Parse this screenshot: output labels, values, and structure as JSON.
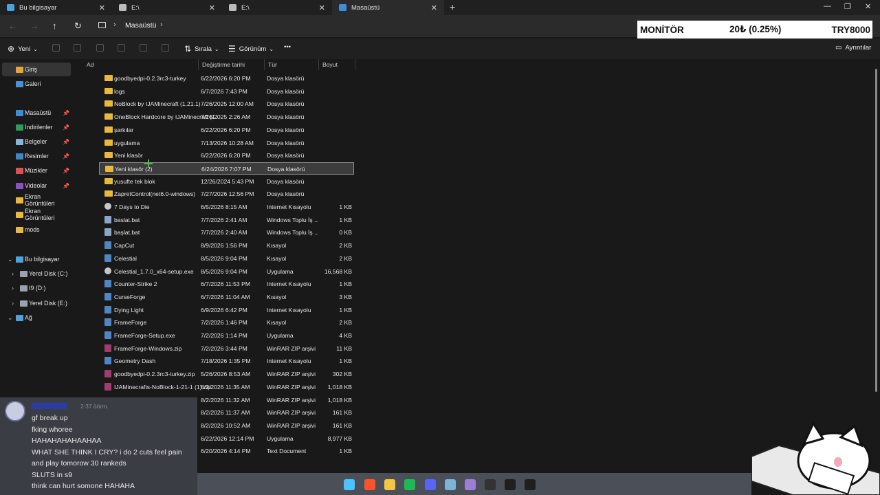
{
  "tabs": [
    {
      "label": "Bu bilgisayar",
      "active": false
    },
    {
      "label": "E:\\",
      "active": false
    },
    {
      "label": "E:\\",
      "active": false
    },
    {
      "label": "Masaüstü",
      "active": true
    }
  ],
  "address": {
    "crumb": "Masaüstü"
  },
  "ticker": {
    "label": "MONİTÖR",
    "change": "20₺ (0.25%)",
    "price": "TRY8000"
  },
  "toolbar": {
    "new_label": "Yeni",
    "sort_label": "Sırala",
    "view_label": "Görünüm",
    "more_label": "•••",
    "details_label": "Ayrıntılar"
  },
  "sidebar": {
    "items": [
      {
        "label": "Giriş",
        "icon": "home-icon",
        "color": "#e8a33a",
        "selected": true,
        "pinned": false
      },
      {
        "label": "Galeri",
        "icon": "gallery-icon",
        "color": "#4a90d9",
        "selected": false,
        "pinned": false
      },
      {
        "label": "Masaüstü",
        "icon": "desktop-icon",
        "color": "#3a8fd8",
        "selected": false,
        "pinned": true
      },
      {
        "label": "İndirilenler",
        "icon": "download-icon",
        "color": "#2a9d5a",
        "selected": false,
        "pinned": true
      },
      {
        "label": "Belgeler",
        "icon": "documents-icon",
        "color": "#8ab4e0",
        "selected": false,
        "pinned": true
      },
      {
        "label": "Resimler",
        "icon": "pictures-icon",
        "color": "#3a86c8",
        "selected": false,
        "pinned": true
      },
      {
        "label": "Müzikler",
        "icon": "music-icon",
        "color": "#d9534f",
        "selected": false,
        "pinned": true
      },
      {
        "label": "Videolar",
        "icon": "videos-icon",
        "color": "#8a4fc6",
        "selected": false,
        "pinned": true
      },
      {
        "label": "Ekran Görüntüleri",
        "icon": "folder-icon",
        "color": "#e9b83c",
        "selected": false,
        "pinned": false
      },
      {
        "label": "Ekran Görüntüleri",
        "icon": "folder-icon",
        "color": "#e9b83c",
        "selected": false,
        "pinned": false
      },
      {
        "label": "mods",
        "icon": "folder-icon",
        "color": "#e9b83c",
        "selected": false,
        "pinned": false
      }
    ],
    "pc": {
      "label": "Bu bilgisayar"
    },
    "drives": [
      {
        "label": "Yerel Disk (C:)"
      },
      {
        "label": "I9 (D:)"
      },
      {
        "label": "Yerel Disk (E:)"
      }
    ],
    "network": {
      "label": "Ağ"
    }
  },
  "columns": {
    "name": "Ad",
    "modified": "Değiştirme tarihi",
    "type": "Tür",
    "size": "Boyut"
  },
  "files": [
    {
      "name": "goodbyedpi-0.2.3rc3-turkey",
      "date": "6/22/2026 6:20 PM",
      "type": "Dosya klasörü",
      "size": "",
      "kind": "folder"
    },
    {
      "name": "logs",
      "date": "6/7/2026 7:43 PM",
      "type": "Dosya klasörü",
      "size": "",
      "kind": "folder"
    },
    {
      "name": "NoBlock by IJAMinecraft (1.21.1)",
      "date": "7/26/2025 12:00 AM",
      "type": "Dosya klasörü",
      "size": "",
      "kind": "folder"
    },
    {
      "name": "OneBlock Hardcore by IJAMinecraft (1.21...",
      "date": "7/26/2025 2:26 AM",
      "type": "Dosya klasörü",
      "size": "",
      "kind": "folder"
    },
    {
      "name": "şarkılar",
      "date": "6/22/2026 6:20 PM",
      "type": "Dosya klasörü",
      "size": "",
      "kind": "folder"
    },
    {
      "name": "uygulama",
      "date": "7/13/2026 10:28 AM",
      "type": "Dosya klasörü",
      "size": "",
      "kind": "folder"
    },
    {
      "name": "Yeni klasör",
      "date": "6/22/2026 6:20 PM",
      "type": "Dosya klasörü",
      "size": "",
      "kind": "folder"
    },
    {
      "name": "Yeni klasör (2)",
      "date": "6/24/2026 7:07 PM",
      "type": "Dosya klasörü",
      "size": "",
      "kind": "folder",
      "selected": true
    },
    {
      "name": "yusufte tek blok",
      "date": "12/26/2024 5:43 PM",
      "type": "Dosya klasörü",
      "size": "",
      "kind": "folder"
    },
    {
      "name": "ZapretControl(net6.0-windows)",
      "date": "7/27/2026 12:56 PM",
      "type": "Dosya klasörü",
      "size": "",
      "kind": "folder"
    },
    {
      "name": "7 Days to Die",
      "date": "6/5/2026 8:15 AM",
      "type": "Internet Kısayolu",
      "size": "1 KB",
      "kind": "link"
    },
    {
      "name": "baslat.bat",
      "date": "7/7/2026 2:41 AM",
      "type": "Windows Toplu İş ...",
      "size": "1 KB",
      "kind": "file"
    },
    {
      "name": "başlat.bat",
      "date": "7/7/2026 2:40 AM",
      "type": "Windows Toplu İş ...",
      "size": "0 KB",
      "kind": "file"
    },
    {
      "name": "CapCut",
      "date": "8/9/2026 1:56 PM",
      "type": "Kısayol",
      "size": "2 KB",
      "kind": "app"
    },
    {
      "name": "Celestial",
      "date": "8/5/2026 9:04 PM",
      "type": "Kısayol",
      "size": "2 KB",
      "kind": "app"
    },
    {
      "name": "Celestial_1.7.0_x64-setup.exe",
      "date": "8/5/2026 9:04 PM",
      "type": "Uygulama",
      "size": "16,568 KB",
      "kind": "link"
    },
    {
      "name": "Counter-Strike 2",
      "date": "6/7/2026 11:53 PM",
      "type": "Internet Kısayolu",
      "size": "1 KB",
      "kind": "app"
    },
    {
      "name": "CurseForge",
      "date": "6/7/2026 11:04 AM",
      "type": "Kısayol",
      "size": "3 KB",
      "kind": "app"
    },
    {
      "name": "Dying Light",
      "date": "6/9/2026 6:42 PM",
      "type": "Internet Kısayolu",
      "size": "1 KB",
      "kind": "app"
    },
    {
      "name": "FrameForge",
      "date": "7/2/2026 1:46 PM",
      "type": "Kısayol",
      "size": "2 KB",
      "kind": "app"
    },
    {
      "name": "FrameForge-Setup.exe",
      "date": "7/2/2026 1:14 PM",
      "type": "Uygulama",
      "size": "4 KB",
      "kind": "app"
    },
    {
      "name": "FrameForge-Windows.zip",
      "date": "7/2/2026 3:44 PM",
      "type": "WinRAR ZIP arşivi",
      "size": "11 KB",
      "kind": "zip"
    },
    {
      "name": "Geometry Dash",
      "date": "7/18/2026 1:35 PM",
      "type": "Internet Kısayolu",
      "size": "1 KB",
      "kind": "app"
    },
    {
      "name": "goodbyedpi-0.2.3rc3-turkey.zip",
      "date": "5/26/2026 8:53 AM",
      "type": "WinRAR ZIP arşivi",
      "size": "302 KB",
      "kind": "zip"
    },
    {
      "name": "IJAMinecrafts-NoBlock-1-21-1 (1).zip",
      "date": "8/2/2026 11:35 AM",
      "type": "WinRAR ZIP arşivi",
      "size": "1,018 KB",
      "kind": "zip"
    },
    {
      "name": "",
      "date": "8/2/2026 11:32 AM",
      "type": "WinRAR ZIP arşivi",
      "size": "1,018 KB",
      "kind": "none"
    },
    {
      "name": "",
      "date": "8/2/2026 11:37 AM",
      "type": "WinRAR ZIP arşivi",
      "size": "161 KB",
      "kind": "none"
    },
    {
      "name": "",
      "date": "8/2/2026 10:52 AM",
      "type": "WinRAR ZIP arşivi",
      "size": "161 KB",
      "kind": "none"
    },
    {
      "name": "",
      "date": "6/22/2026 12:14 PM",
      "type": "Uygulama",
      "size": "8,977 KB",
      "kind": "none"
    },
    {
      "name": "",
      "date": "6/20/2026 4:14 PM",
      "type": "Text Document",
      "size": "1 KB",
      "kind": "none"
    }
  ],
  "chat": {
    "time": "2:37 öörm.",
    "messages": [
      "gf break up",
      "fking whoree",
      "HAHAHAHAHAAHAA",
      "WHAT SHE THINK I CRY?  i do 2 cuts feel pain",
      "and play tomorow 30 rankeds",
      "SLUTS in s9",
      "think can hurt somone HAHAHA"
    ]
  },
  "taskbar": {
    "icons": [
      {
        "name": "windows-start-icon",
        "color": "#4cc2ff"
      },
      {
        "name": "brave-icon",
        "color": "#fb542b"
      },
      {
        "name": "file-explorer-icon",
        "color": "#f4c542"
      },
      {
        "name": "spotify-icon",
        "color": "#1db954"
      },
      {
        "name": "discord-icon",
        "color": "#5865f2"
      },
      {
        "name": "app-icon",
        "color": "#7fb3d5"
      },
      {
        "name": "app-icon",
        "color": "#9b7fd4"
      },
      {
        "name": "obs-icon",
        "color": "#333333"
      },
      {
        "name": "epic-games-icon",
        "color": "#1f1f1f"
      },
      {
        "name": "capcut-icon",
        "color": "#1f1f1f"
      }
    ]
  }
}
